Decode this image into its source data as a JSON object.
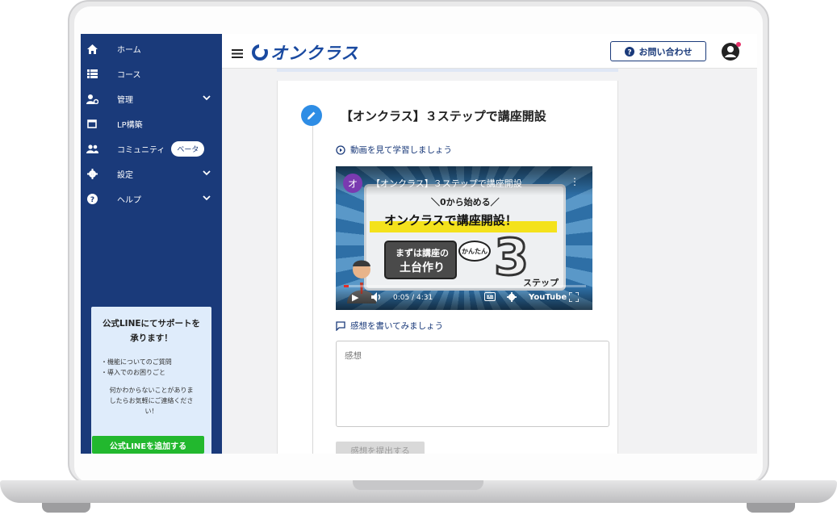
{
  "sidebar": {
    "items": [
      {
        "label": "ホーム",
        "icon": "home-icon"
      },
      {
        "label": "コース",
        "icon": "list-icon"
      },
      {
        "label": "管理",
        "icon": "user-gear-icon"
      },
      {
        "label": "LP構築",
        "icon": "window-icon"
      },
      {
        "label": "コミュニティ",
        "icon": "people-icon",
        "badge": "ベータ"
      },
      {
        "label": "設定",
        "icon": "gear-icon"
      },
      {
        "label": "ヘルプ",
        "icon": "help-icon"
      }
    ],
    "promo": {
      "title_line1": "公式LINEにてサポートを",
      "title_line2": "承ります！",
      "bullet1": "・機能についてのご質問",
      "bullet2": "・導入でのお困りごと",
      "text_line1": "何かわからないことがありま",
      "text_line2": "したらお気軽にご連絡くださ",
      "text_line3": "い！",
      "button": "公式LINEを追加する"
    }
  },
  "header": {
    "logo": "オンクラス",
    "contact_button": "お問い合わせ"
  },
  "main": {
    "lesson_title": "【オンクラス】３ステップで講座開設",
    "watch_label": "動画を見て学習しましょう",
    "video": {
      "channel_initial": "オ",
      "title": "【オンクラス】３ステップで講座開設",
      "subtitle": "＼0から始める／",
      "headline": "オンクラスで講座開設！",
      "box_line1": "まずは講座の",
      "box_line2": "土台作り",
      "bubble": "かんたん",
      "big_number": "3",
      "step_label": "ステップ",
      "time": "0:05 / 4:31",
      "progress": 0.02,
      "brand": "YouTube"
    },
    "comment_label": "感想を書いてみましょう",
    "comment_placeholder": "感想",
    "submit_button": "感想を提出する"
  },
  "colors": {
    "sidebar_bg": "#1a3a7a",
    "accent_blue": "#2e8de5",
    "line_green": "#22b82e",
    "promo_bg": "#dfecfb"
  }
}
